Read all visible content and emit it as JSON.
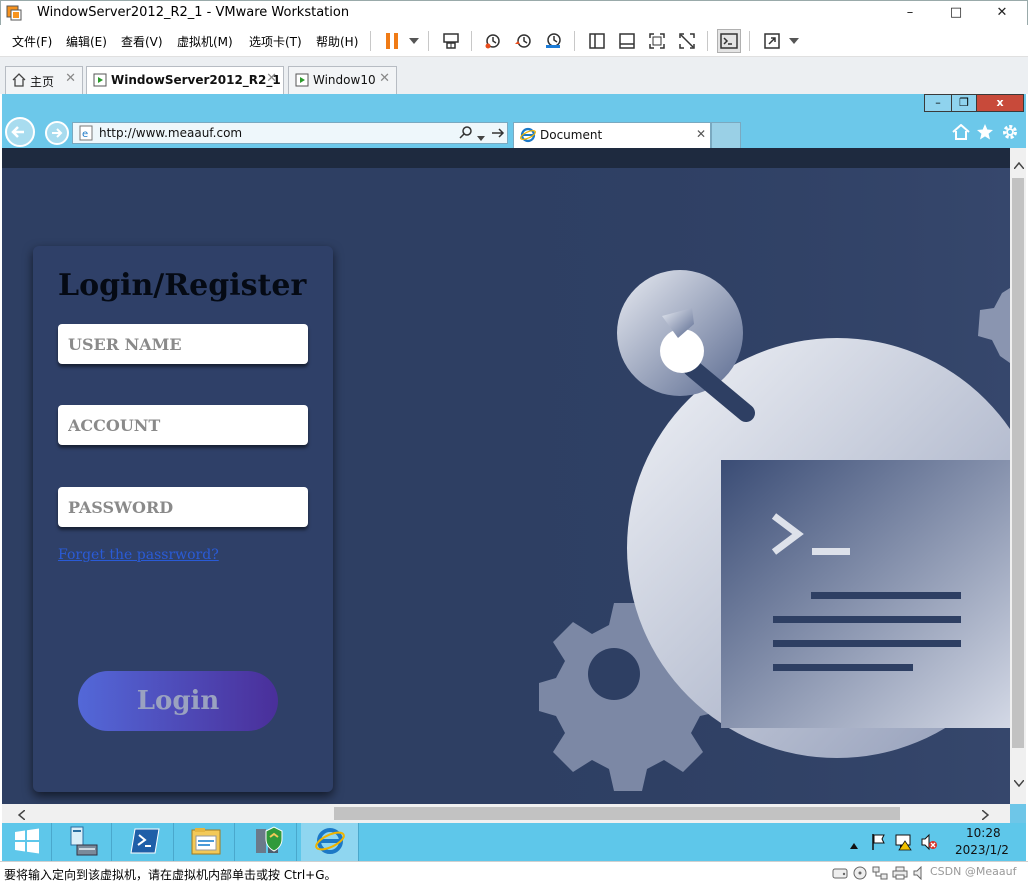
{
  "window": {
    "title": "WindowServer2012_R2_1 - VMware Workstation",
    "controls": {
      "minimize": "–",
      "maximize": "□",
      "close": "✕"
    }
  },
  "menu": {
    "items": [
      "文件(F)",
      "编辑(E)",
      "查看(V)",
      "虚拟机(M)",
      "选项卡(T)",
      "帮助(H)"
    ]
  },
  "toolbar": {
    "icons": [
      "pause-icon",
      "dropdown-icon",
      "send-ctrl-alt-del-icon",
      "snapshot-icon",
      "revert-snapshot-icon",
      "snapshot-manager-icon",
      "show-library-icon",
      "thumbnail-bar-icon",
      "full-screen-icon",
      "unity-icon",
      "console-view-icon",
      "stretch-guest-icon"
    ]
  },
  "vm_tabs": [
    {
      "label": "主页",
      "icon": "home-icon"
    },
    {
      "label": "WindowServer2012_R2_1",
      "icon": "vm-running-icon",
      "active": true
    },
    {
      "label": "Window10",
      "icon": "vm-running-icon"
    }
  ],
  "browser": {
    "url": "http://www.meaauf.com",
    "tab_title": "Document",
    "window_buttons": {
      "minimize": "–",
      "restore": "❐",
      "close": "x"
    }
  },
  "page": {
    "login_title": "Login/Register",
    "fields": {
      "username_placeholder": "USER NAME",
      "account_placeholder": "ACCOUNT",
      "password_placeholder": "PASSWORD"
    },
    "forgot_link": "Forget the passrword?",
    "login_button": "Login"
  },
  "taskbar": {
    "time": "10:28",
    "date": "2023/1/2"
  },
  "statusbar": {
    "text": "要将输入定向到该虚拟机，请在虚拟机内部单击或按 Ctrl+G。",
    "watermark": "CSDN @Meaauf"
  },
  "colors": {
    "page_bg": "#2e3f63",
    "card_bg": "#2f4068",
    "accent_blue": "#5368d8",
    "accent_purple": "#4a2f9a",
    "taskbar": "#5ec7ea",
    "vmware_pause": "#f07b16"
  }
}
